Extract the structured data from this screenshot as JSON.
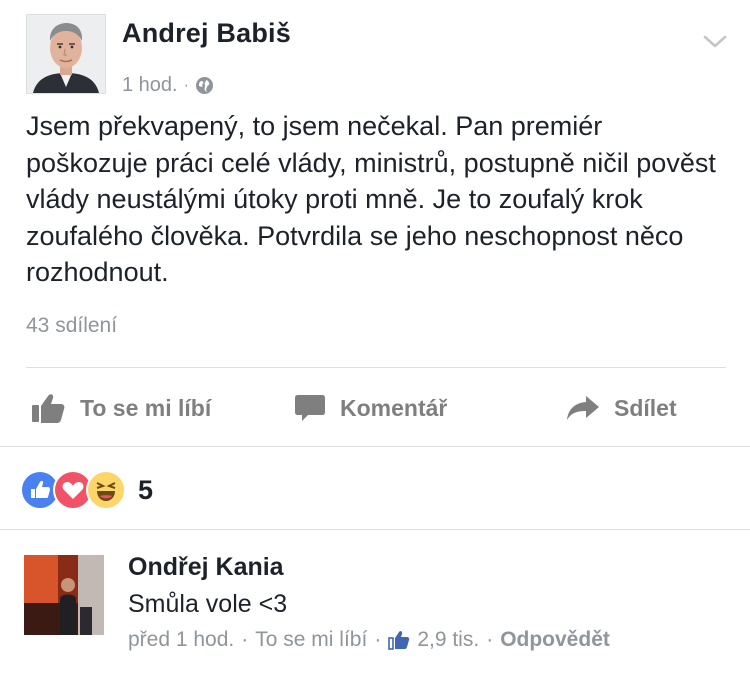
{
  "post": {
    "author": "Andrej Babiš",
    "time": "1 hod.",
    "separator": "·",
    "privacy_icon": "globe-icon",
    "text": "Jsem překvapený, to jsem nečekal. Pan premiér poškozuje práci celé vlády, ministrů, postupně ničil pověst vlády neustálými útoky proti mně. Je to zoufalý krok zoufalého člověka. Potvrdila se jeho neschopnost něco rozhodnout.",
    "shares": "43 sdílení"
  },
  "actions": {
    "like": "To se mi líbí",
    "comment": "Komentář",
    "share": "Sdílet"
  },
  "reactions": {
    "types": [
      "like",
      "love",
      "haha"
    ],
    "count": "5"
  },
  "comment": {
    "author": "Ondřej Kania",
    "text": "Smůla vole <3",
    "time": "před 1 hod.",
    "sep1": "·",
    "like_label": "To se mi líbí",
    "sep2": "·",
    "likes": "2,9 tis.",
    "sep3": "·",
    "reply": "Odpovědět"
  },
  "colors": {
    "text": "#1d2129",
    "secondary": "#90949c",
    "action": "#7f7f7f",
    "like_blue": "#4267b2",
    "love_red": "#f25268",
    "haha_yellow": "#fcd669",
    "divider": "#dddfe2"
  }
}
